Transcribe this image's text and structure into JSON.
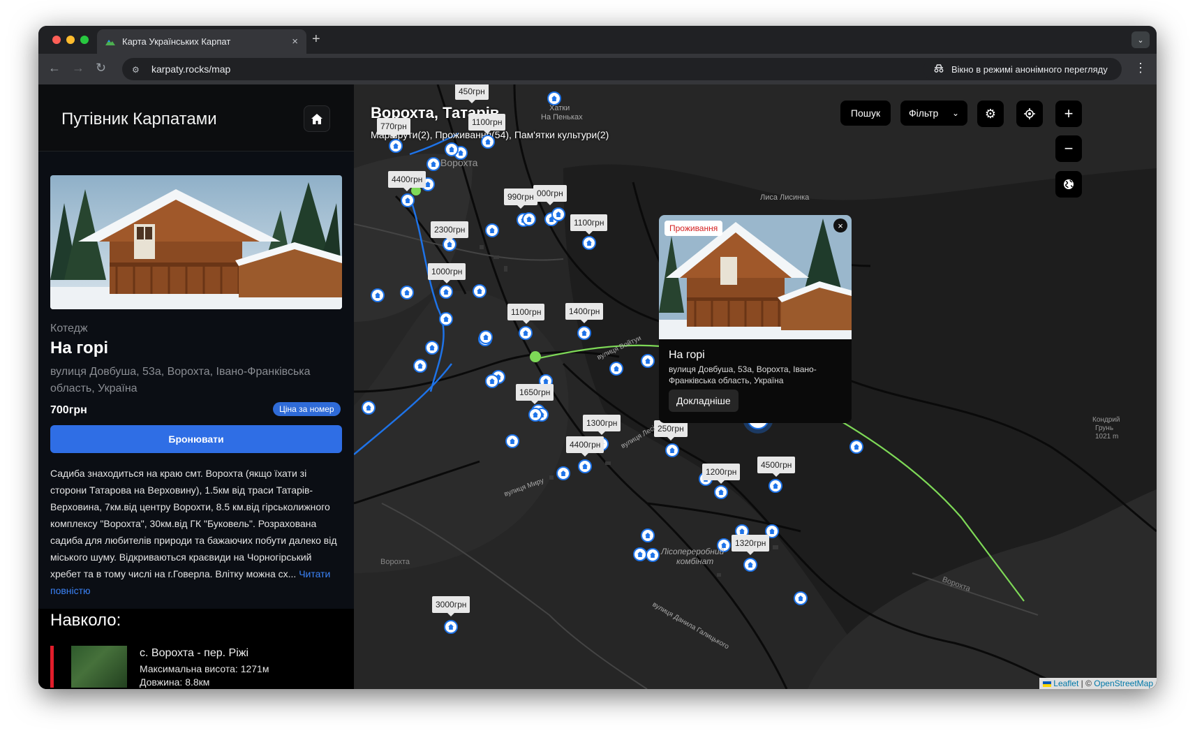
{
  "browser": {
    "tab_title": "Карта Українських Карпат",
    "tab_close": "×",
    "new_tab": "+",
    "url": "karpaty.rocks/map",
    "incognito_label": "Вікно в режимі анонімного перегляду"
  },
  "sidebar": {
    "brand": "Путівник Карпатами",
    "place": {
      "kind": "Котедж",
      "name": "На горі",
      "address": "вулиця Довбуша, 53а, Ворохта, Івано-Франківська область, Україна",
      "price": "700грн",
      "price_badge": "Ціна за номер",
      "book_label": "Бронювати",
      "description": "Садиба знаходиться на краю смт. Ворохта (якщо їхати зі сторони Татарова на Верховину), 1.5км від траси Татарів-Верховина, 7км.від центру Ворохти, 8.5 км.від гірськолижного комплексу \"Ворохта\", 30км.від ГК \"Буковель\". Розрахована садиба для любителів природи та бажаючих побути далеко від міського шуму. Відкриваються краєвиди на Чорногірський хребет та в тому числі на г.Говерла. Влітку можна сх...",
      "read_more": "Читати повністю"
    },
    "around_title": "Навколо:",
    "around_item": {
      "title": "с. Ворохта - пер. Ріжі",
      "max_height": "Максимальна висота: 1271м",
      "length": "Довжина: 8.8км"
    }
  },
  "map": {
    "title": "Ворохта, Татарів",
    "subtitle": "Маршрути(2), Проживання(54), Пам'ятки культури(2)",
    "controls": {
      "search": "Пошук",
      "filter": "Фільтр",
      "zoom_in": "+",
      "zoom_out": "−"
    },
    "place_labels": {
      "vorokhta": "Ворохта",
      "vorokhta2": "Ворохта",
      "vorokhta3": "Ворохта",
      "khatky": "Хатки",
      "na_penkakh": "На Пеньках",
      "lisopererobnyi": "Лісопереробний",
      "kombinat": "комбінат",
      "lysa": "Лиса Лисинка",
      "kondriy": "Кондрий",
      "grun": "Грунь",
      "height": "1021 m",
      "street_vojtyu": "вулиця Войтуи",
      "street_myru": "вулиця Миру",
      "street_lesi": "вулиця Лесі",
      "street_danyla": "вулиця Данила Галицького"
    },
    "price_labels": [
      "450грн",
      "770грн",
      "1100грн",
      "4400грн",
      "990грн",
      "000грн",
      "2300грн",
      "1100грн",
      "1000грн",
      "1100грн",
      "1400грн",
      "1650грн",
      "1300грн",
      "4400грн",
      "250грн",
      "1200грн",
      "4500грн",
      "1320грн",
      "3000грн"
    ],
    "popup": {
      "tag": "Проживання",
      "close": "×",
      "title": "На горі",
      "address": "вулиця Довбуша, 53а, Ворохта, Івано-Франківська область, Україна",
      "button": "Докладніше"
    },
    "attribution": {
      "leaflet": "Leaflet",
      "sep": " | © ",
      "osm": "OpenStreetMap"
    }
  }
}
